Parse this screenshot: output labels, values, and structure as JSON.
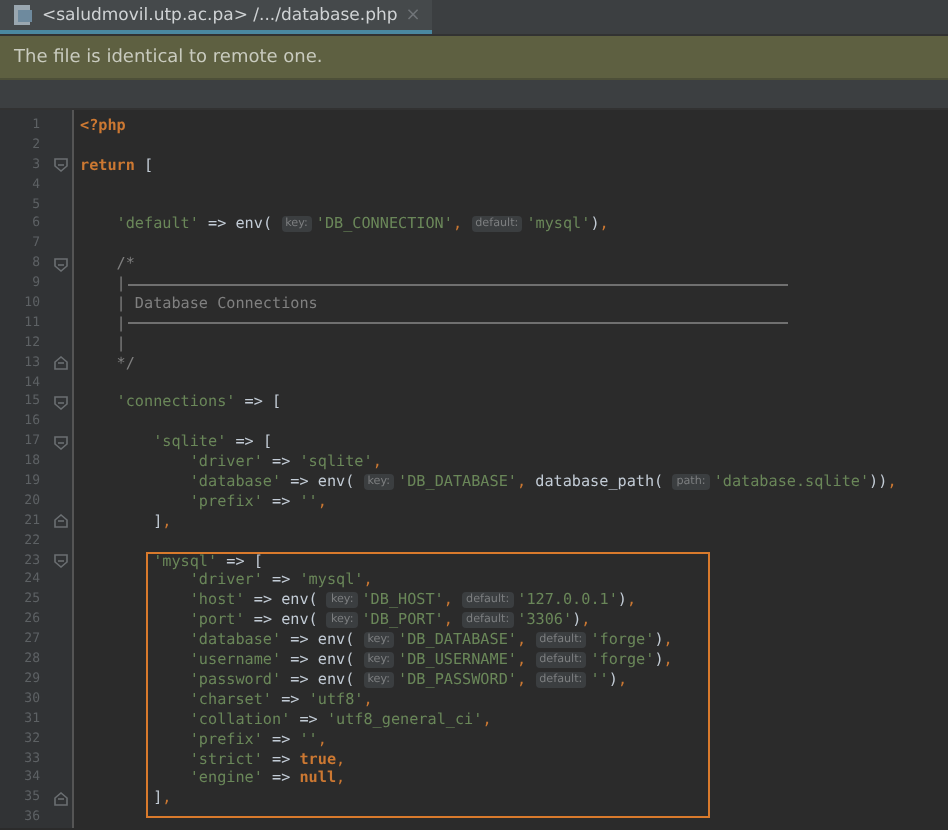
{
  "tab": {
    "label": "<saludmovil.utp.ac.pa> /.../database.php",
    "close": "×",
    "selected": true
  },
  "notification": {
    "text": "The file is identical to remote one."
  },
  "editor": {
    "blocks": [
      {
        "framed": false,
        "lines": [
          {
            "number": "1",
            "tokens": [
              {
                "kind": "kw",
                "text": "<?php"
              }
            ]
          },
          {
            "number": "2"
          },
          {
            "number": "3",
            "fold_start": true,
            "tokens": [
              {
                "kind": "kw",
                "text": "return"
              },
              {
                "kind": "plain",
                "text": " ["
              }
            ]
          },
          {
            "number": "4"
          },
          {
            "number": "5"
          },
          {
            "number": "6",
            "tokens": [
              {
                "kind": "str",
                "text": "    'default'"
              },
              {
                "kind": "plain",
                "text": " => env( "
              },
              {
                "kind": "hint",
                "text": "key:"
              },
              {
                "kind": "str",
                "text": "'DB_CONNECTION'"
              },
              {
                "kind": "punct",
                "text": ", "
              },
              {
                "kind": "hint",
                "text": "default:"
              },
              {
                "kind": "str",
                "text": "'mysql'"
              },
              {
                "kind": "plain",
                "text": ")"
              },
              {
                "kind": "punct",
                "text": ","
              }
            ]
          },
          {
            "number": "7"
          },
          {
            "number": "8",
            "fold_start": true,
            "tokens": [
              {
                "kind": "comment",
                "text": "    /*"
              }
            ]
          },
          {
            "number": "9",
            "rule": true,
            "tokens": [
              {
                "kind": "comment",
                "text": "    |"
              }
            ]
          },
          {
            "number": "10",
            "tokens": [
              {
                "kind": "comment",
                "text": "    | Database Connections"
              }
            ]
          },
          {
            "number": "11",
            "rule": true,
            "tokens": [
              {
                "kind": "comment",
                "text": "    |"
              }
            ]
          },
          {
            "number": "12",
            "tokens": [
              {
                "kind": "comment",
                "text": "    |"
              }
            ]
          },
          {
            "number": "13",
            "fold_end": true,
            "tokens": [
              {
                "kind": "comment",
                "text": "    */"
              }
            ]
          },
          {
            "number": "14"
          },
          {
            "number": "15",
            "fold_start": true,
            "tokens": [
              {
                "kind": "str",
                "text": "    'connections'"
              },
              {
                "kind": "plain",
                "text": " => ["
              }
            ]
          },
          {
            "number": "16"
          },
          {
            "number": "17",
            "fold_start": true,
            "tokens": [
              {
                "kind": "str",
                "text": "        'sqlite'"
              },
              {
                "kind": "plain",
                "text": " => ["
              }
            ]
          },
          {
            "number": "18",
            "tokens": [
              {
                "kind": "str",
                "text": "            'driver'"
              },
              {
                "kind": "plain",
                "text": " => "
              },
              {
                "kind": "str",
                "text": "'sqlite'"
              },
              {
                "kind": "punct",
                "text": ","
              }
            ]
          },
          {
            "number": "19",
            "tokens": [
              {
                "kind": "str",
                "text": "            'database'"
              },
              {
                "kind": "plain",
                "text": " => env( "
              },
              {
                "kind": "hint",
                "text": "key:"
              },
              {
                "kind": "str",
                "text": "'DB_DATABASE'"
              },
              {
                "kind": "punct",
                "text": ", "
              },
              {
                "kind": "plain",
                "text": "database_path( "
              },
              {
                "kind": "hint",
                "text": "path:"
              },
              {
                "kind": "str",
                "text": "'database.sqlite'"
              },
              {
                "kind": "plain",
                "text": "))"
              },
              {
                "kind": "punct",
                "text": ","
              }
            ]
          },
          {
            "number": "20",
            "tokens": [
              {
                "kind": "str",
                "text": "            'prefix'"
              },
              {
                "kind": "plain",
                "text": " => "
              },
              {
                "kind": "str",
                "text": "''"
              },
              {
                "kind": "punct",
                "text": ","
              }
            ]
          },
          {
            "number": "21",
            "fold_end": true,
            "tokens": [
              {
                "kind": "plain",
                "text": "        ]"
              },
              {
                "kind": "punct",
                "text": ","
              }
            ]
          },
          {
            "number": "22"
          }
        ]
      },
      {
        "framed": true,
        "lines": [
          {
            "number": "23",
            "fold_start": true,
            "tokens": [
              {
                "kind": "str",
                "text": "        'mysql'"
              },
              {
                "kind": "plain",
                "text": " => ["
              }
            ]
          },
          {
            "number": "24",
            "tokens": [
              {
                "kind": "str",
                "text": "            'driver'"
              },
              {
                "kind": "plain",
                "text": " => "
              },
              {
                "kind": "str",
                "text": "'mysql'"
              },
              {
                "kind": "punct",
                "text": ","
              }
            ]
          },
          {
            "number": "25",
            "tokens": [
              {
                "kind": "str",
                "text": "            'host'"
              },
              {
                "kind": "plain",
                "text": " => env( "
              },
              {
                "kind": "hint",
                "text": "key:"
              },
              {
                "kind": "str",
                "text": "'DB_HOST'"
              },
              {
                "kind": "punct",
                "text": ", "
              },
              {
                "kind": "hint",
                "text": "default:"
              },
              {
                "kind": "str",
                "text": "'127.0.0.1'"
              },
              {
                "kind": "plain",
                "text": ")"
              },
              {
                "kind": "punct",
                "text": ","
              }
            ]
          },
          {
            "number": "26",
            "tokens": [
              {
                "kind": "str",
                "text": "            'port'"
              },
              {
                "kind": "plain",
                "text": " => env( "
              },
              {
                "kind": "hint",
                "text": "key:"
              },
              {
                "kind": "str",
                "text": "'DB_PORT'"
              },
              {
                "kind": "punct",
                "text": ", "
              },
              {
                "kind": "hint",
                "text": "default:"
              },
              {
                "kind": "str",
                "text": "'3306'"
              },
              {
                "kind": "plain",
                "text": ")"
              },
              {
                "kind": "punct",
                "text": ","
              }
            ]
          },
          {
            "number": "27",
            "tokens": [
              {
                "kind": "str",
                "text": "            'database'"
              },
              {
                "kind": "plain",
                "text": " => env( "
              },
              {
                "kind": "hint",
                "text": "key:"
              },
              {
                "kind": "str",
                "text": "'DB_DATABASE'"
              },
              {
                "kind": "punct",
                "text": ", "
              },
              {
                "kind": "hint",
                "text": "default:"
              },
              {
                "kind": "str",
                "text": "'forge'"
              },
              {
                "kind": "plain",
                "text": ")"
              },
              {
                "kind": "punct",
                "text": ","
              }
            ]
          },
          {
            "number": "28",
            "tokens": [
              {
                "kind": "str",
                "text": "            'username'"
              },
              {
                "kind": "plain",
                "text": " => env( "
              },
              {
                "kind": "hint",
                "text": "key:"
              },
              {
                "kind": "str",
                "text": "'DB_USERNAME'"
              },
              {
                "kind": "punct",
                "text": ", "
              },
              {
                "kind": "hint",
                "text": "default:"
              },
              {
                "kind": "str",
                "text": "'forge'"
              },
              {
                "kind": "plain",
                "text": ")"
              },
              {
                "kind": "punct",
                "text": ","
              }
            ]
          },
          {
            "number": "29",
            "tokens": [
              {
                "kind": "str",
                "text": "            'password'"
              },
              {
                "kind": "plain",
                "text": " => env( "
              },
              {
                "kind": "hint",
                "text": "key:"
              },
              {
                "kind": "str",
                "text": "'DB_PASSWORD'"
              },
              {
                "kind": "punct",
                "text": ", "
              },
              {
                "kind": "hint",
                "text": "default:"
              },
              {
                "kind": "str",
                "text": "''"
              },
              {
                "kind": "plain",
                "text": ")"
              },
              {
                "kind": "punct",
                "text": ","
              }
            ]
          },
          {
            "number": "30",
            "tokens": [
              {
                "kind": "str",
                "text": "            'charset'"
              },
              {
                "kind": "plain",
                "text": " => "
              },
              {
                "kind": "str",
                "text": "'utf8'"
              },
              {
                "kind": "punct",
                "text": ","
              }
            ]
          },
          {
            "number": "31",
            "tokens": [
              {
                "kind": "str",
                "text": "            'collation'"
              },
              {
                "kind": "plain",
                "text": " => "
              },
              {
                "kind": "str",
                "text": "'utf8_general_ci'"
              },
              {
                "kind": "punct",
                "text": ","
              }
            ]
          },
          {
            "number": "32",
            "tokens": [
              {
                "kind": "str",
                "text": "            'prefix'"
              },
              {
                "kind": "plain",
                "text": " => "
              },
              {
                "kind": "str",
                "text": "''"
              },
              {
                "kind": "punct",
                "text": ","
              }
            ]
          },
          {
            "number": "33",
            "tokens": [
              {
                "kind": "str",
                "text": "            'strict'"
              },
              {
                "kind": "plain",
                "text": " => "
              },
              {
                "kind": "kw",
                "text": "true"
              },
              {
                "kind": "punct",
                "text": ","
              }
            ]
          },
          {
            "number": "34",
            "tokens": [
              {
                "kind": "str",
                "text": "            'engine'"
              },
              {
                "kind": "plain",
                "text": " => "
              },
              {
                "kind": "kw",
                "text": "null"
              },
              {
                "kind": "punct",
                "text": ","
              }
            ]
          },
          {
            "number": "35",
            "fold_end": true,
            "tokens": [
              {
                "kind": "plain",
                "text": "        ]"
              },
              {
                "kind": "punct",
                "text": ","
              }
            ]
          }
        ]
      },
      {
        "framed": false,
        "lines": [
          {
            "number": "36"
          }
        ]
      }
    ]
  }
}
